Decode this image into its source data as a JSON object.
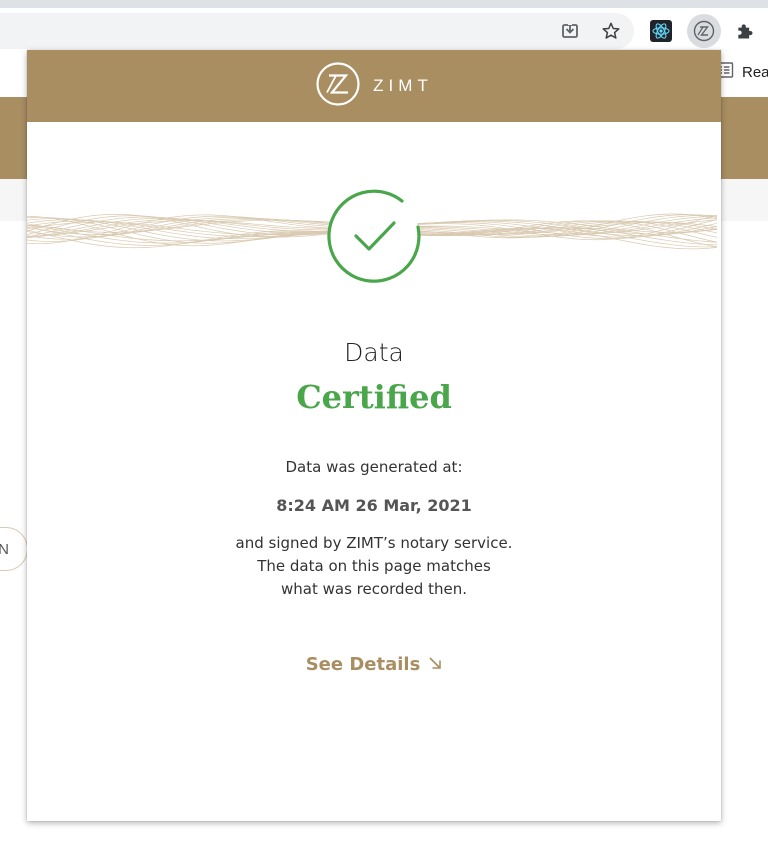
{
  "browser": {
    "reading_list_label": "Rea",
    "icons": {
      "download": "download-icon",
      "bookmark": "star-icon",
      "react_extension": "react-devtools-icon",
      "zimt_extension": "zimt-extension-icon",
      "extensions": "puzzle-icon",
      "reading_list": "reading-list-icon"
    }
  },
  "page": {
    "pill_button_text": "N"
  },
  "popup": {
    "brand": {
      "name": "ZIMT",
      "logo_icon": "zimt-logo-icon"
    },
    "status_icon": "check-circle-icon",
    "title_line1": "Data",
    "title_line2": "Certified",
    "generated_label": "Data was generated at:",
    "generated_time": "8:24 AM 26 Mar, 2021",
    "explanation_lines": [
      "and signed by ZIMT’s notary service.",
      "The data on this page matches",
      "what was recorded then."
    ],
    "see_details_label": "See Details",
    "see_details_icon": "arrow-down-right-icon",
    "colors": {
      "brand_gold": "#a98e62",
      "success_green": "#4aa64a"
    }
  }
}
